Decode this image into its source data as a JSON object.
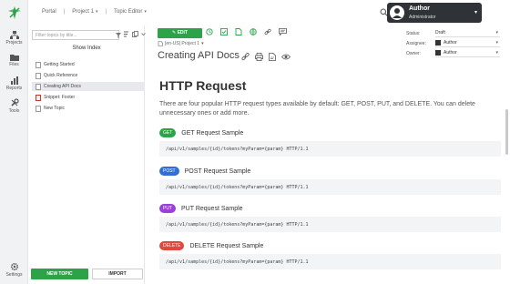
{
  "rail": {
    "items": [
      {
        "label": "Projects",
        "icon": "folder-tree-icon"
      },
      {
        "label": "Files",
        "icon": "folder-icon"
      },
      {
        "label": "Reports",
        "icon": "chart-icon"
      },
      {
        "label": "Tools",
        "icon": "wrench-icon"
      }
    ],
    "settings_label": "Settings"
  },
  "topbar": {
    "breadcrumbs": [
      "Portal",
      "Project 1",
      "Topic Editor"
    ],
    "user": {
      "name": "Author",
      "role": "Administrator"
    }
  },
  "panel": {
    "filter_placeholder": "Filter topics by title...",
    "show_index": "Show Index",
    "topics": [
      {
        "label": "Getting Started",
        "selected": false,
        "type": "doc"
      },
      {
        "label": "Quick Reference",
        "selected": false,
        "type": "doc"
      },
      {
        "label": "Creating API Docs",
        "selected": true,
        "type": "doc"
      },
      {
        "label": "Snippet: Footer",
        "selected": false,
        "type": "pdf"
      },
      {
        "label": "New Topic",
        "selected": false,
        "type": "doc"
      }
    ],
    "new_topic": "NEW TOPIC",
    "import": "IMPORT"
  },
  "editor": {
    "edit_label": "EDIT",
    "project_line": "[en-US] Project 1",
    "doc_title": "Creating API Docs"
  },
  "meta": {
    "status_label": "Status:",
    "status_value": "Draft",
    "assignee_label": "Assignee:",
    "assignee_value": "Author",
    "owner_label": "Owner:",
    "owner_value": "Author"
  },
  "content": {
    "heading": "HTTP Request",
    "intro": "There are four popular HTTP request types available by default: GET, POST, PUT, and DELETE. You can delete unnecessary ones or add more.",
    "samples": [
      {
        "badge": "GET",
        "color": "#2ca349",
        "title": "GET Request Sample",
        "code": "/api/v1/samples/{id}/tokens?myParam={param} HTTP/1.1"
      },
      {
        "badge": "POST",
        "color": "#2f6fd6",
        "title": "POST Request Sample",
        "code": "/api/v1/samples/{id}/tokens?myParam={param} HTTP/1.1"
      },
      {
        "badge": "PUT",
        "color": "#9b3fd6",
        "title": "PUT Request Sample",
        "code": "/api/v1/samples/{id}/tokens?myParam={param} HTTP/1.1"
      },
      {
        "badge": "DELETE",
        "color": "#e0483b",
        "title": "DELETE Request Sample",
        "code": "/api/v1/samples/{id}/tokens?myParam={param} HTTP/1.1"
      }
    ]
  }
}
